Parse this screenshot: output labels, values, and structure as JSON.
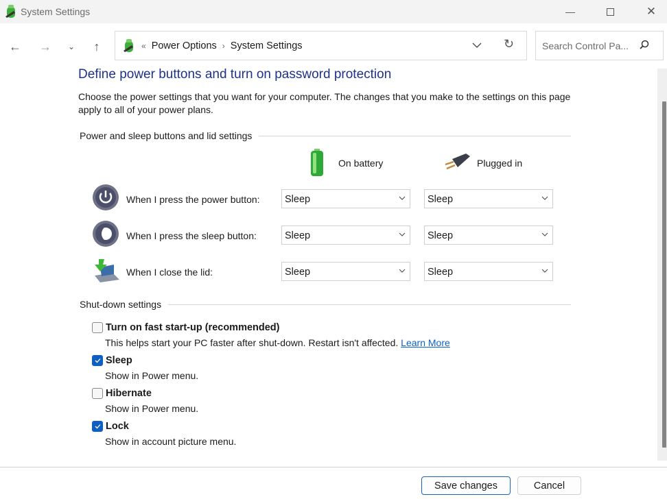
{
  "window": {
    "title": "System Settings"
  },
  "nav": {
    "breadcrumb": [
      "Power Options",
      "System Settings"
    ],
    "breadcrumb_overflow": "«",
    "search_placeholder": "Search Control Pa..."
  },
  "page": {
    "title": "Define power buttons and turn on password protection",
    "description": "Choose the power settings that you want for your computer. The changes that you make to the settings on this page apply to all of your power plans.",
    "section1": "Power and sleep buttons and lid settings",
    "columns": [
      "On battery",
      "Plugged in"
    ],
    "rows": [
      {
        "label": "When I press the power button:",
        "on_battery": "Sleep",
        "plugged_in": "Sleep",
        "icon": "power-button-icon"
      },
      {
        "label": "When I press the sleep button:",
        "on_battery": "Sleep",
        "plugged_in": "Sleep",
        "icon": "sleep-button-icon"
      },
      {
        "label": "When I close the lid:",
        "on_battery": "Sleep",
        "plugged_in": "Sleep",
        "icon": "laptop-lid-icon"
      }
    ],
    "section2": "Shut-down settings",
    "shutdown": [
      {
        "label": "Turn on fast start-up (recommended)",
        "desc": "This helps start your PC faster after shut-down. Restart isn't affected.",
        "link": "Learn More",
        "checked": false
      },
      {
        "label": "Sleep",
        "desc": "Show in Power menu.",
        "checked": true
      },
      {
        "label": "Hibernate",
        "desc": "Show in Power menu.",
        "checked": false
      },
      {
        "label": "Lock",
        "desc": "Show in account picture menu.",
        "checked": true
      }
    ]
  },
  "footer": {
    "save": "Save changes",
    "cancel": "Cancel"
  },
  "colors": {
    "title": "#1e3287",
    "accent": "#0f5fc0",
    "link": "#0a63c9"
  }
}
